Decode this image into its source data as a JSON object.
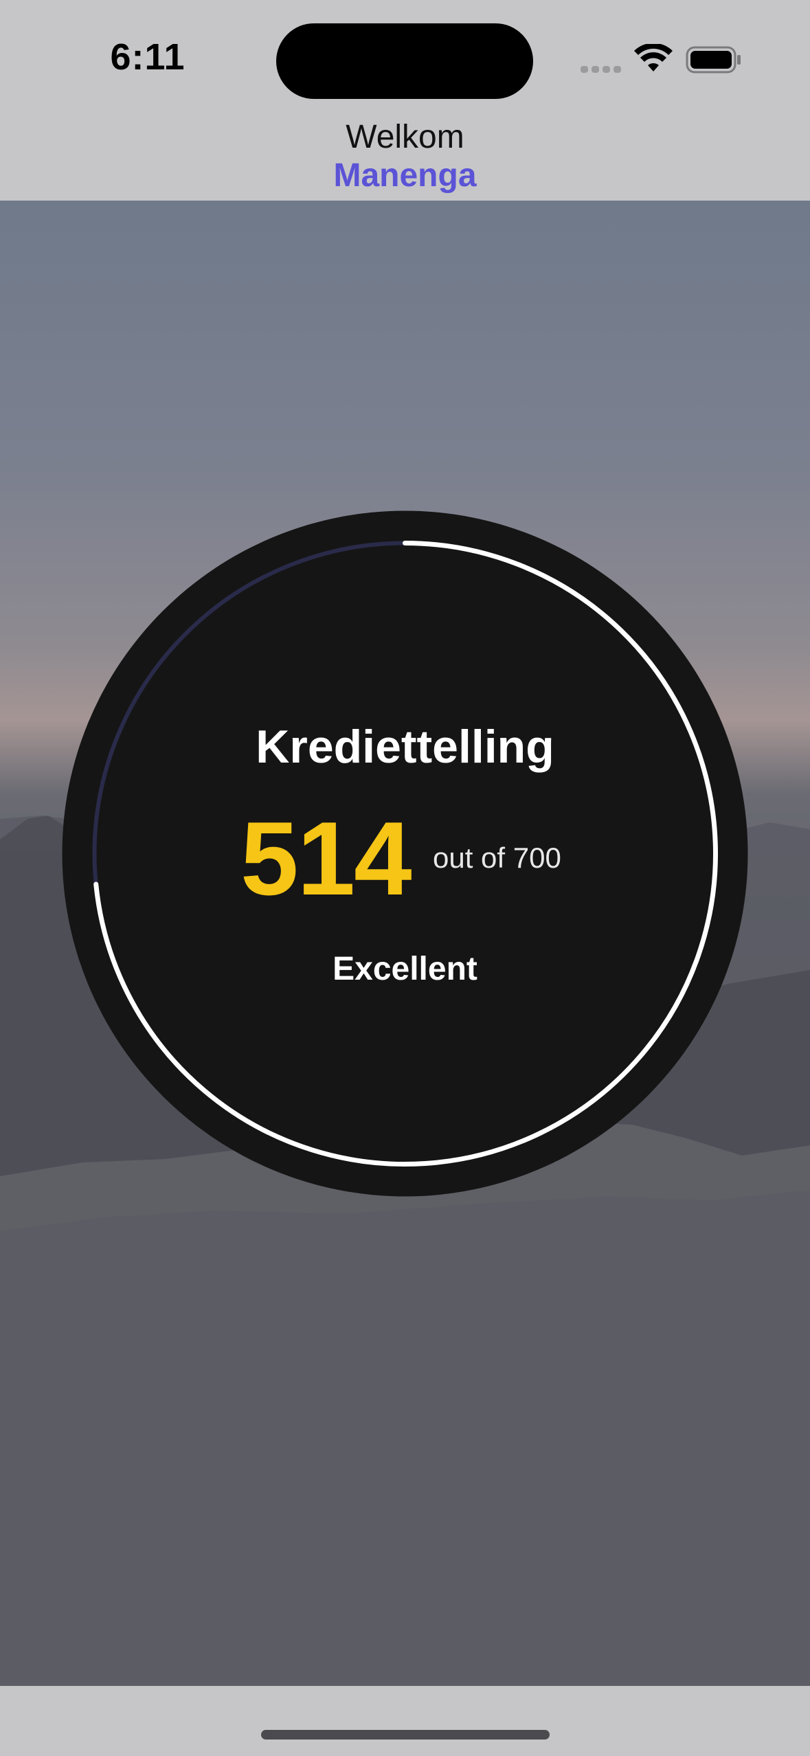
{
  "status_bar": {
    "time": "6:11"
  },
  "header": {
    "welcome": "Welkom",
    "user_name": "Manenga"
  },
  "credit_score": {
    "title": "Krediettelling",
    "score": "514",
    "max_label": "out of 700",
    "score_value": 514,
    "score_max": 700,
    "rating": "Excellent",
    "colors": {
      "score": "#f6c515",
      "progress": "#ffffff",
      "track": "#2a2a4a",
      "disc": "#151515"
    }
  },
  "colors": {
    "accent": "#5b53d6"
  },
  "icons": [
    "signal-icon",
    "wifi-icon",
    "battery-icon"
  ]
}
